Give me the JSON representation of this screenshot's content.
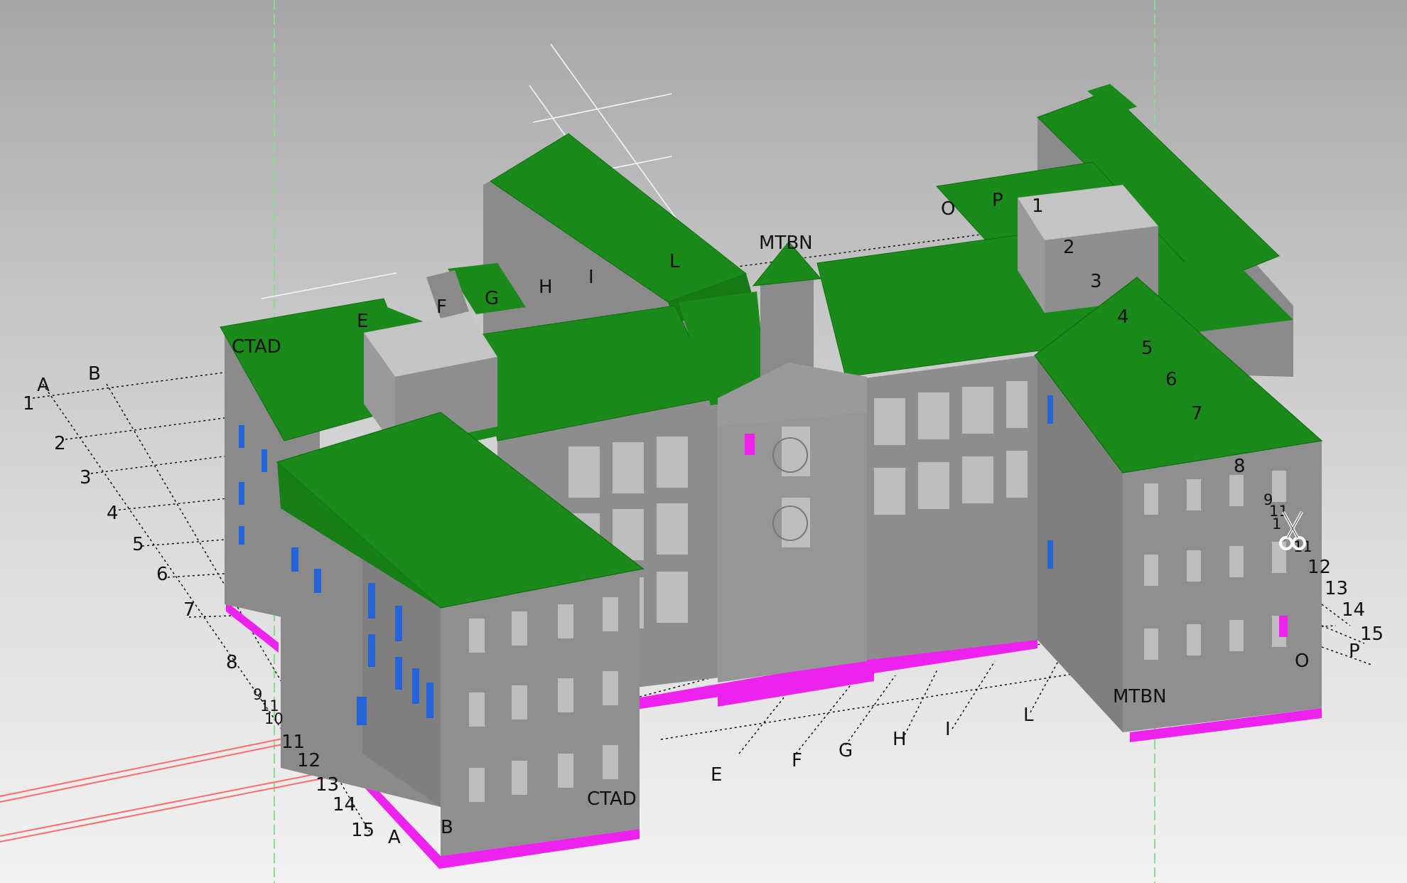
{
  "viewport": {
    "name": "3D model viewport",
    "colors": {
      "roof": "#1a8a1a",
      "roof_edge": "#0f6e0f",
      "wall": "#8e8e8e",
      "wall_light": "#9c9c9c",
      "foundation": "#ee22ee",
      "window": "#2563d8",
      "grid_line": "#000000",
      "section_line": "#ff6b6b",
      "guide_line": "#8fd98f"
    }
  },
  "grid": {
    "letters_top_left": [
      "A",
      "B"
    ],
    "numbers_left": [
      "1",
      "2",
      "3",
      "4",
      "5",
      "6",
      "7",
      "8",
      "9",
      "11",
      "10",
      "11",
      "12",
      "13",
      "14",
      "15"
    ],
    "letters_bottom": [
      "A",
      "B",
      "CTAD",
      "E",
      "F",
      "G",
      "H",
      "I",
      "L",
      "MTBN",
      "O",
      "P"
    ],
    "numbers_right": [
      "8",
      "9",
      "11",
      "1",
      "11",
      "12",
      "13",
      "14",
      "15"
    ],
    "letters_roof": [
      "CTAD",
      "E",
      "F",
      "G",
      "H",
      "I",
      "L",
      "MTBN",
      "O",
      "P"
    ],
    "numbers_roof": [
      "1",
      "2",
      "3",
      "4",
      "5",
      "6",
      "7"
    ]
  },
  "tool": {
    "icon": "scissors-cursor-icon"
  }
}
